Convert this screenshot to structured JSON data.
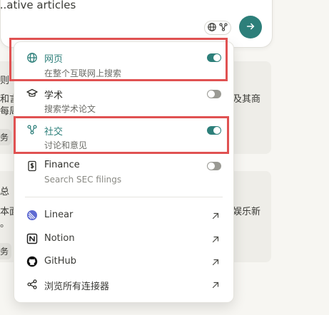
{
  "composer": {
    "input_text": "...ative articles",
    "tools_icon": "globe-network-icon",
    "send_icon": "arrow-right-icon"
  },
  "background": {
    "card1_lines": [
      "则",
      "和言",
      "每周"
    ],
    "card1_right": "及其商",
    "card1_pill": "务",
    "card2_lines": [
      "总",
      "本面",
      "。"
    ],
    "card2_right": "娱乐新",
    "card2_pill": "务"
  },
  "menu": {
    "sources": [
      {
        "title": "网页",
        "subtitle": "在整个互联网上搜索",
        "icon": "globe-icon",
        "enabled": true
      },
      {
        "title": "学术",
        "subtitle": "搜索学术论文",
        "icon": "graduation-cap-icon",
        "enabled": false
      },
      {
        "title": "社交",
        "subtitle": "讨论和意见",
        "icon": "social-network-icon",
        "enabled": true
      },
      {
        "title": "Finance",
        "subtitle": "Search SEC filings",
        "icon": "dollar-document-icon",
        "enabled": false
      }
    ],
    "connectors": [
      {
        "label": "Linear",
        "icon": "linear-logo-icon"
      },
      {
        "label": "Notion",
        "icon": "notion-logo-icon"
      },
      {
        "label": "GitHub",
        "icon": "github-logo-icon"
      },
      {
        "label": "浏览所有连接器",
        "icon": "share-nodes-icon"
      }
    ]
  },
  "colors": {
    "accent": "#2d7f7a",
    "highlight": "#e05252",
    "toggle_off": "#9a9a94"
  }
}
